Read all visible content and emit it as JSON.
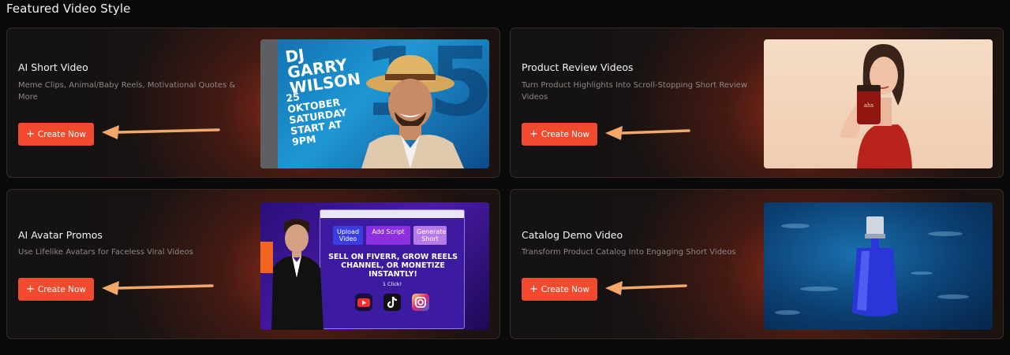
{
  "section": {
    "title": "Featured Video Style"
  },
  "cards": [
    {
      "title": "AI Short Video",
      "description": "Meme Clips, Animal/Baby Reels, Motivational Quotes & More",
      "button": {
        "icon": "plus-icon",
        "label": "Create Now"
      },
      "thumbnail": {
        "dj_name": "DJ GARRY WILSON",
        "date_text": "25 OKTOBER SATURDAY START AT 9PM",
        "big_number": "15"
      }
    },
    {
      "title": "Product Review Videos",
      "description": "Turn Product Highlights Into Scroll-Stopping Short Review Videos",
      "button": {
        "icon": "plus-icon",
        "label": "Create Now"
      },
      "thumbnail": {
        "product_label": "ahs"
      }
    },
    {
      "title": "AI Avatar Promos",
      "description": "Use Lifelike Avatars for Faceless Viral Videos",
      "button": {
        "icon": "plus-icon",
        "label": "Create Now"
      },
      "thumbnail": {
        "steps": [
          "Upload Video",
          "Add Script",
          "Generate Short"
        ],
        "headline": "SELL ON FIVERR, GROW REELS CHANNEL, OR MONETIZE INSTANTLY!",
        "sub": "1 Click!",
        "social_icons": [
          "youtube-icon",
          "tiktok-icon",
          "instagram-icon"
        ]
      }
    },
    {
      "title": "Catalog Demo Video",
      "description": "Transform Product Catalog Into Engaging Short Videos",
      "button": {
        "icon": "plus-icon",
        "label": "Create Now"
      },
      "thumbnail": {}
    }
  ],
  "colors": {
    "accent": "#f24a2e",
    "arrow": "#f3a86a",
    "background": "#0b0a0a",
    "card_glow": "#b2341c"
  }
}
